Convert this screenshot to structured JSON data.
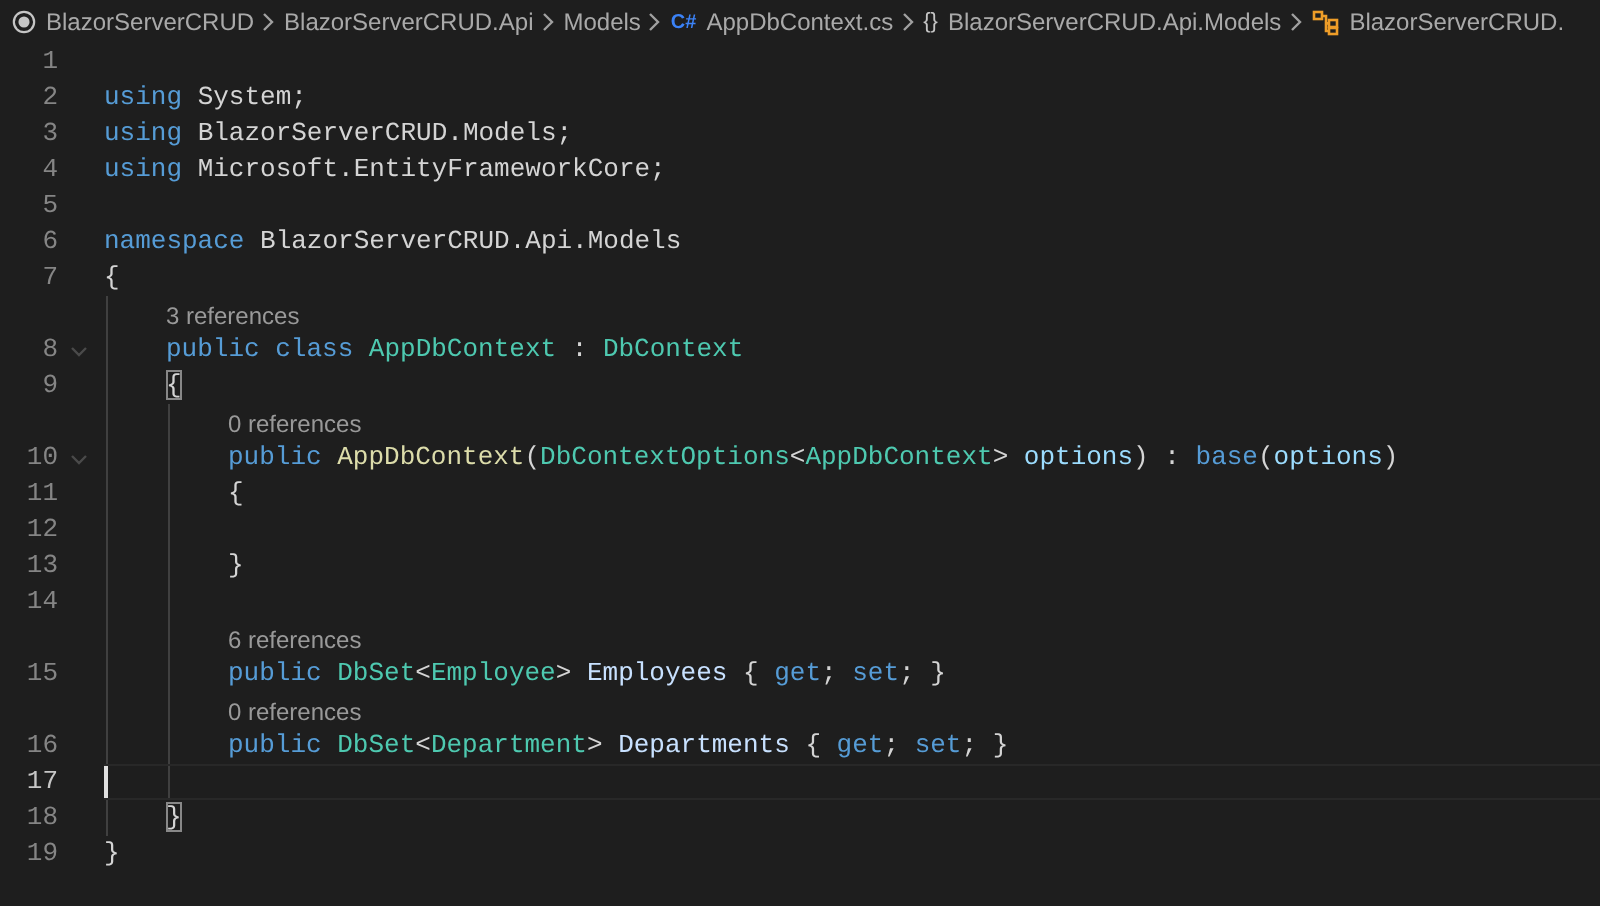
{
  "breadcrumb": [
    {
      "kind": "root",
      "label": "BlazorServerCRUD"
    },
    {
      "kind": "folder",
      "label": "BlazorServerCRUD.Api"
    },
    {
      "kind": "folder",
      "label": "Models"
    },
    {
      "kind": "file",
      "icon_text": "C#",
      "label": "AppDbContext.cs"
    },
    {
      "kind": "namespace",
      "icon_text": "{}",
      "label": "BlazorServerCRUD.Api.Models"
    },
    {
      "kind": "class",
      "label": "BlazorServerCRUD."
    }
  ],
  "lines": [
    {
      "number": "1",
      "current": false,
      "fold_marker": false
    },
    {
      "number": "2",
      "current": false,
      "fold_marker": false,
      "tokens": [
        {
          "kind": "keyword",
          "text": "using"
        },
        {
          "kind": "plain",
          "text": " System;"
        }
      ]
    },
    {
      "number": "3",
      "current": false,
      "fold_marker": false,
      "tokens": [
        {
          "kind": "keyword",
          "text": "using"
        },
        {
          "kind": "plain",
          "text": " BlazorServerCRUD.Models;"
        }
      ]
    },
    {
      "number": "4",
      "current": false,
      "fold_marker": false,
      "tokens": [
        {
          "kind": "keyword",
          "text": "using"
        },
        {
          "kind": "plain",
          "text": " Microsoft.EntityFrameworkCore;"
        }
      ]
    },
    {
      "number": "5",
      "current": false,
      "fold_marker": false
    },
    {
      "number": "6",
      "current": false,
      "fold_marker": false,
      "tokens": [
        {
          "kind": "keyword",
          "text": "namespace"
        },
        {
          "kind": "plain",
          "text": " BlazorServerCRUD.Api.Models"
        }
      ]
    },
    {
      "number": "7",
      "current": false,
      "fold_marker": false,
      "tokens": [
        {
          "kind": "plain",
          "text": "{"
        }
      ],
      "children": [
        {
          "number": "8",
          "current": false,
          "fold_marker": true,
          "codelens": "3 references",
          "tokens": [
            {
              "kind": "keyword",
              "text": "public class"
            },
            {
              "kind": "type",
              "text": " AppDbContext"
            },
            {
              "kind": "plain",
              "text": " : "
            },
            {
              "kind": "type",
              "text": "DbContext"
            }
          ]
        },
        {
          "number": "9",
          "current": false,
          "fold_marker": false,
          "tokens": [
            {
              "kind": "bracket",
              "matched": true,
              "text": "{"
            }
          ],
          "children": [
            {
              "number": "10",
              "current": false,
              "fold_marker": true,
              "codelens": "0 references",
              "tokens": [
                {
                  "kind": "keyword",
                  "text": "public"
                },
                {
                  "kind": "method",
                  "text": " AppDbContext"
                },
                {
                  "kind": "plain",
                  "text": "("
                },
                {
                  "kind": "type",
                  "text": "DbContextOptions"
                },
                {
                  "kind": "plain",
                  "text": "<"
                },
                {
                  "kind": "type",
                  "text": "AppDbContext"
                },
                {
                  "kind": "plain",
                  "text": ">"
                },
                {
                  "kind": "variable",
                  "text": " options"
                },
                {
                  "kind": "plain",
                  "text": ") : "
                },
                {
                  "kind": "keyword",
                  "text": "base"
                },
                {
                  "kind": "plain",
                  "text": "("
                },
                {
                  "kind": "variable",
                  "text": "options"
                },
                {
                  "kind": "plain",
                  "text": ")"
                }
              ]
            },
            {
              "number": "11",
              "current": false,
              "fold_marker": false,
              "tokens": [
                {
                  "kind": "plain",
                  "text": "{"
                }
              ]
            },
            {
              "number": "12",
              "current": false,
              "fold_marker": false
            },
            {
              "number": "13",
              "current": false,
              "fold_marker": false,
              "tokens": [
                {
                  "kind": "plain",
                  "text": "}"
                }
              ]
            },
            {
              "number": "14",
              "current": false,
              "fold_marker": false
            },
            {
              "number": "15",
              "current": false,
              "fold_marker": false,
              "codelens": "6 references",
              "tokens": [
                {
                  "kind": "keyword",
                  "text": "public"
                },
                {
                  "kind": "type",
                  "text": " DbSet"
                },
                {
                  "kind": "plain",
                  "text": "<"
                },
                {
                  "kind": "type",
                  "text": "Employee"
                },
                {
                  "kind": "plain",
                  "text": ">"
                },
                {
                  "kind": "property",
                  "text": " Employees"
                },
                {
                  "kind": "plain",
                  "text": " { "
                },
                {
                  "kind": "keyword",
                  "text": "get"
                },
                {
                  "kind": "plain",
                  "text": "; "
                },
                {
                  "kind": "keyword",
                  "text": "set"
                },
                {
                  "kind": "plain",
                  "text": "; }"
                }
              ]
            },
            {
              "number": "16",
              "current": false,
              "fold_marker": false,
              "codelens": "0 references",
              "tokens": [
                {
                  "kind": "keyword",
                  "text": "public"
                },
                {
                  "kind": "type",
                  "text": " DbSet"
                },
                {
                  "kind": "plain",
                  "text": "<"
                },
                {
                  "kind": "type",
                  "text": "Department"
                },
                {
                  "kind": "plain",
                  "text": ">"
                },
                {
                  "kind": "property",
                  "text": " Departments"
                },
                {
                  "kind": "plain",
                  "text": " { "
                },
                {
                  "kind": "keyword",
                  "text": "get"
                },
                {
                  "kind": "plain",
                  "text": "; "
                },
                {
                  "kind": "keyword",
                  "text": "set"
                },
                {
                  "kind": "plain",
                  "text": "; }"
                }
              ]
            },
            {
              "number": "17",
              "current": true,
              "fold_marker": false
            }
          ]
        },
        {
          "number": "18",
          "current": false,
          "fold_marker": false,
          "tokens": [
            {
              "kind": "bracket",
              "matched": true,
              "text": "}"
            }
          ]
        }
      ]
    },
    {
      "number": "19",
      "current": false,
      "fold_marker": false,
      "tokens": [
        {
          "kind": "plain",
          "text": "}"
        }
      ]
    }
  ]
}
